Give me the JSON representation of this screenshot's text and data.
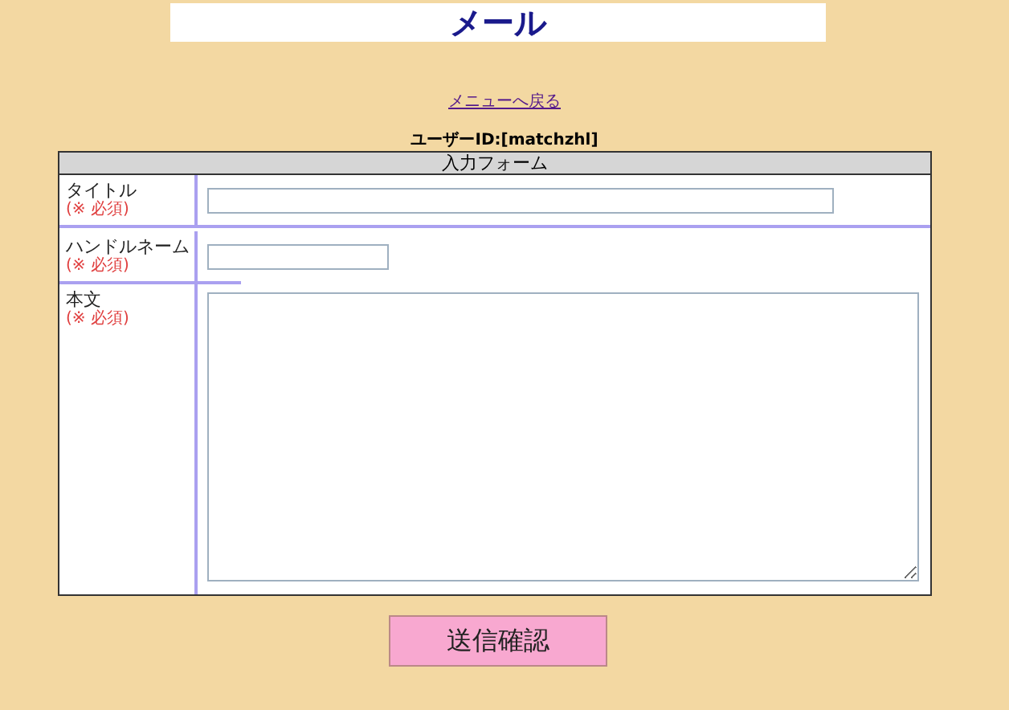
{
  "title": "メール",
  "back_link": "メニューへ戻る",
  "user_id": "ユーザーID:[matchzhl]",
  "form": {
    "heading": "入力フォーム",
    "rows": [
      {
        "kind": "text",
        "label": "タイトル",
        "required": "(※ 必須)"
      },
      {
        "kind": "short",
        "label": "ハンドルネーム",
        "required": "(※ 必須)"
      },
      {
        "kind": "textarea",
        "label": "本文",
        "required": "(※ 必須)"
      }
    ]
  },
  "submit": "送信確認"
}
